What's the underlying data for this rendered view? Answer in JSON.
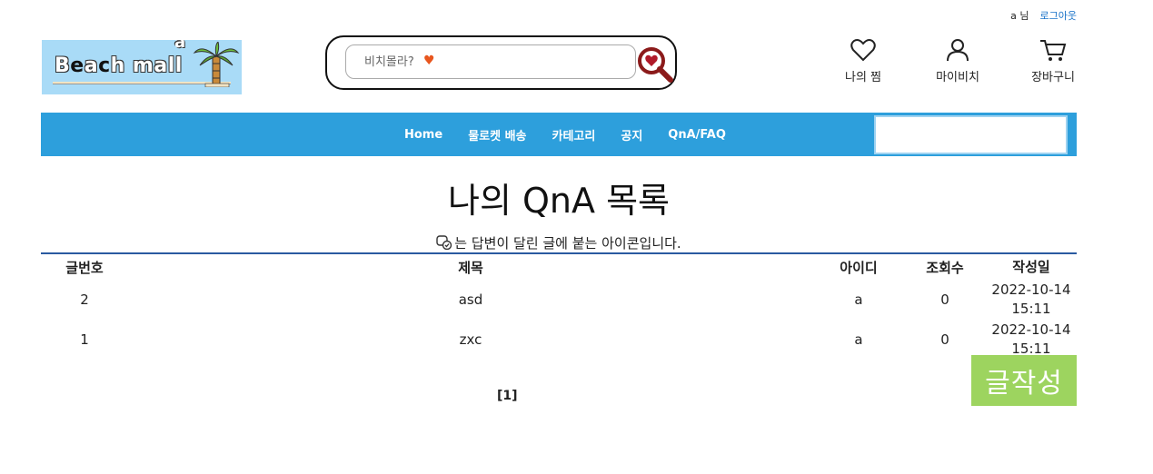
{
  "topbar": {
    "user": "a 님",
    "logout": "로그아웃"
  },
  "logo": {
    "text_a": "B",
    "text_dark1": "e",
    "text_mid": "a",
    "text_dark2": "c",
    "text_end": "h mall",
    "top_letter": "a"
  },
  "search": {
    "placeholder": "비치몰라?",
    "heart": "♥"
  },
  "header_icons": [
    {
      "label": "나의 찜",
      "icon": "heart-outline-icon"
    },
    {
      "label": "마이비치",
      "icon": "user-icon"
    },
    {
      "label": "장바구니",
      "icon": "cart-icon"
    }
  ],
  "nav": {
    "items": [
      "Home",
      "물로켓 배송",
      "카테고리",
      "공지",
      "QnA/FAQ"
    ]
  },
  "page": {
    "title": "나의 QnA 목록",
    "notice": "는 답변이 달린 글에 붙는 아이콘입니다."
  },
  "table": {
    "headers": {
      "no": "글번호",
      "title": "제목",
      "id": "아이디",
      "views": "조회수",
      "date": "작성일"
    },
    "rows": [
      {
        "no": "2",
        "title": "asd",
        "id": "a",
        "views": "0",
        "date1": "2022-10-14",
        "date2": "15:11"
      },
      {
        "no": "1",
        "title": "zxc",
        "id": "a",
        "views": "0",
        "date1": "2022-10-14",
        "date2": "15:11"
      }
    ]
  },
  "pager": {
    "current": "[1]"
  },
  "write_button": "글작성",
  "colors": {
    "nav": "#2d9fdc",
    "write": "#9dd45f",
    "logout": "#1a73c8",
    "table_border": "#2a5aa0"
  }
}
